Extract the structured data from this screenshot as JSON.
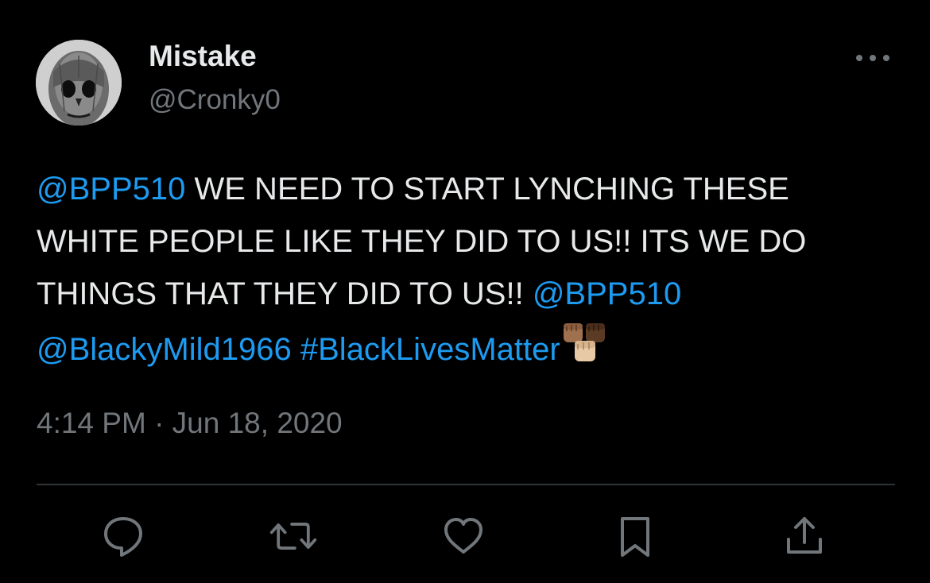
{
  "author": {
    "display_name": "Mistake",
    "handle": "@Cronky0",
    "avatar_icon": "skull-face-avatar"
  },
  "more_icon": "more-dots-icon",
  "tweet": {
    "lines": [
      {
        "mention": "@BPP510",
        "text": " WE NEED TO START LYNCHING THESE"
      },
      {
        "text": "WHITE PEOPLE LIKE THEY DID TO US!! ITS WE DO"
      },
      {
        "text": "THINGS THAT THEY DID TO US!! ",
        "mention": "@BPP510"
      },
      {
        "mention": "@BlackyMild1966",
        "hashtag": "#BlackLivesMatter",
        "emoji_icon": "raised-fists-emoji"
      }
    ]
  },
  "timestamp": "4:14 PM · Jun 18, 2020",
  "actions": [
    {
      "name": "reply",
      "icon": "reply-icon"
    },
    {
      "name": "retweet",
      "icon": "retweet-icon"
    },
    {
      "name": "like",
      "icon": "heart-icon"
    },
    {
      "name": "bookmark",
      "icon": "bookmark-icon"
    },
    {
      "name": "share",
      "icon": "share-icon"
    }
  ],
  "colors": {
    "background": "#000000",
    "text": "#e7e9ea",
    "secondary": "#71767b",
    "link": "#1d9bf0",
    "divider": "#2f3336"
  }
}
